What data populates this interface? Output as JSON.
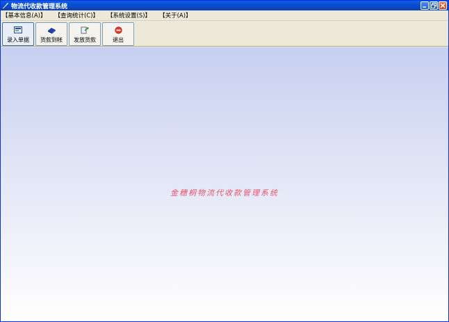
{
  "window": {
    "title": "物流代收款管理系统"
  },
  "menu": [
    {
      "label": "【基本信息(A)】"
    },
    {
      "label": "【查询统计(C)】"
    },
    {
      "label": "【系统设置(S)】"
    },
    {
      "label": "【关于(A)】"
    }
  ],
  "toolbar": [
    {
      "label": "录入单据",
      "icon": "form-entry-icon"
    },
    {
      "label": "货款到帐",
      "icon": "payment-received-icon"
    },
    {
      "label": "发放货款",
      "icon": "payout-icon"
    },
    {
      "label": "退出",
      "icon": "exit-icon"
    }
  ],
  "main": {
    "watermark": "金穗桐物流代收款管理系统"
  },
  "colors": {
    "titlebar": "#0a4fd0",
    "watermark": "#e8576a",
    "background_top": "#c6cff0",
    "background_bottom": "#ffffff"
  }
}
